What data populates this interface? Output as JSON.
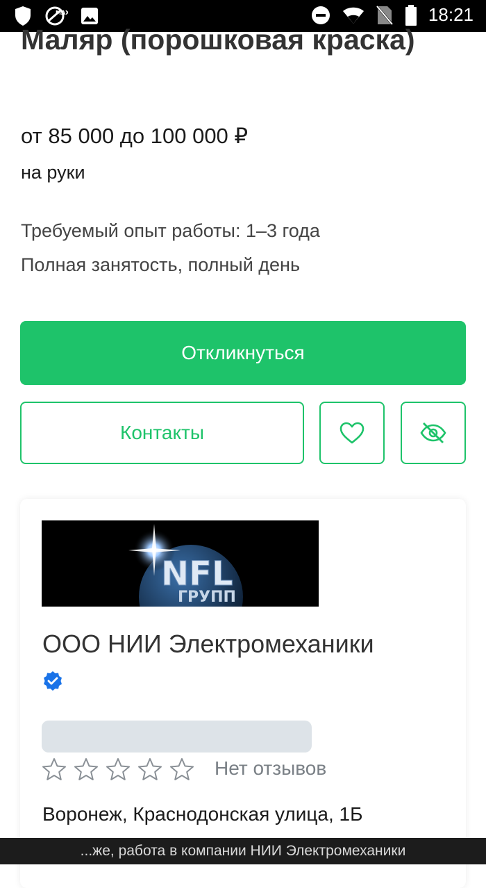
{
  "status_bar": {
    "time": "18:21",
    "left_icons": [
      "shield-icon",
      "max-app-icon",
      "image-icon"
    ],
    "right_icons": [
      "do-not-disturb-icon",
      "wifi-icon",
      "no-sim-icon",
      "battery-icon"
    ]
  },
  "vacancy": {
    "title": "Маляр (порошковая краска)",
    "salary": "от 85 000 до 100 000 ₽",
    "salary_note": "на руки",
    "experience": "Требуемый опыт работы: 1–3 года",
    "employment": "Полная занятость, полный день"
  },
  "actions": {
    "apply_label": "Откликнуться",
    "contacts_label": "Контакты",
    "favorite_icon": "heart-icon",
    "hide_icon": "eye-off-icon"
  },
  "company": {
    "logo_text_main": "NFL",
    "logo_text_sub": "ГРУПП",
    "name": "ООО НИИ Электромеханики",
    "verified_icon": "verified-badge-icon",
    "rating_stars": 0,
    "rating_max": 5,
    "reviews_label": "Нет отзывов",
    "address": "Воронеж, Краснодонская улица, 1Б"
  },
  "bottom_banner": {
    "text": "...же, работа в компании НИИ Электромеханики"
  },
  "colors": {
    "accent": "#1ec36a",
    "verified": "#1a73e8",
    "status_bar": "#000000"
  }
}
